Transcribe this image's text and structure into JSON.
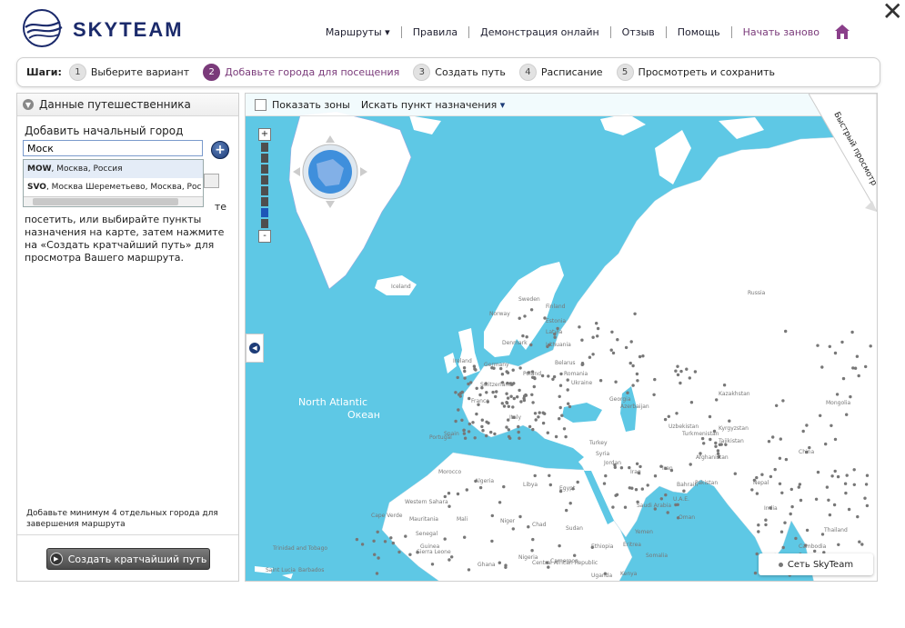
{
  "brand": {
    "name": "SKYTEAM"
  },
  "nav": {
    "items": [
      "Маршруты ▾",
      "Правила",
      "Демонстрация онлайн",
      "Отзыв",
      "Помощь",
      "Начать заново"
    ]
  },
  "close_label": "✕",
  "steps": {
    "label": "Шаги:",
    "items": [
      {
        "num": "1",
        "text": "Выберите вариант"
      },
      {
        "num": "2",
        "text": "Добавьте города для посещения"
      },
      {
        "num": "3",
        "text": "Создать путь"
      },
      {
        "num": "4",
        "text": "Расписание"
      },
      {
        "num": "5",
        "text": "Просмотреть и сохранить"
      }
    ],
    "active_index": 1
  },
  "sidebar": {
    "header": "Данные путешественника",
    "add_start_label": "Добавить начальный город",
    "city_input_value": "Моск",
    "suggestions": [
      {
        "code": "MOW",
        "rest": ", Москва, Россия"
      },
      {
        "code": "SVO",
        "rest": ", Москва Шереметьево, Москва, Рос"
      }
    ],
    "instructions_lead": "те",
    "instructions": "посетить, или выбирайте пункты назначения на карте, затем нажмите на «Создать кратчайший путь» для просмотра Вашего маршрута.",
    "min_note": "Добавьте минимум 4 отдельных города для завершения маршрута",
    "shortest_button": "Создать кратчайший путь"
  },
  "map": {
    "show_zones": "Показать зоны",
    "find_destination": "Искать пункт назначения",
    "quick_view": "Быстрый просмотр",
    "network_button": "Сеть SkyTeam",
    "ocean_label_1": "North Atlantic",
    "ocean_label_2": "Океан",
    "zoom_level": 7,
    "zoom_levels": 8,
    "country_labels": [
      {
        "t": "Iceland"
      },
      {
        "t": "Norway"
      },
      {
        "t": "Sweden"
      },
      {
        "t": "Finland"
      },
      {
        "t": "Estonia"
      },
      {
        "t": "Latvia"
      },
      {
        "t": "Lithuania"
      },
      {
        "t": "Belarus"
      },
      {
        "t": "Poland"
      },
      {
        "t": "Ukraine"
      },
      {
        "t": "France"
      },
      {
        "t": "Spain"
      },
      {
        "t": "Portugal"
      },
      {
        "t": "Italy"
      },
      {
        "t": "Turkey"
      },
      {
        "t": "Syria"
      },
      {
        "t": "Iraq"
      },
      {
        "t": "Iran"
      },
      {
        "t": "Libya"
      },
      {
        "t": "Egypt"
      },
      {
        "t": "Algeria"
      },
      {
        "t": "Morocco"
      },
      {
        "t": "Mali"
      },
      {
        "t": "Niger"
      },
      {
        "t": "Chad"
      },
      {
        "t": "Sudan"
      },
      {
        "t": "Ethiopia"
      },
      {
        "t": "Yemen"
      },
      {
        "t": "Kazakhstan"
      },
      {
        "t": "Uzbekistan"
      },
      {
        "t": "Turkmenistan"
      },
      {
        "t": "Kyrgyzstan"
      },
      {
        "t": "Afghanistan"
      },
      {
        "t": "Pakistan"
      },
      {
        "t": "China"
      },
      {
        "t": "Mongolia"
      },
      {
        "t": "Russia"
      },
      {
        "t": "Nepal"
      },
      {
        "t": "India"
      },
      {
        "t": "Thailand"
      },
      {
        "t": "Nigeria"
      },
      {
        "t": "Cameroon"
      },
      {
        "t": "Senegal"
      },
      {
        "t": "Mauritania"
      },
      {
        "t": "U.A.E."
      },
      {
        "t": "Oman"
      },
      {
        "t": "Eritrea"
      },
      {
        "t": "Somalia"
      },
      {
        "t": "Kenya"
      },
      {
        "t": "Uganda"
      },
      {
        "t": "Ghana"
      },
      {
        "t": "Tajikistan"
      },
      {
        "t": "Azerbaijan"
      },
      {
        "t": "Georgia"
      },
      {
        "t": "Germany"
      },
      {
        "t": "Switzerland"
      },
      {
        "t": "Romania"
      },
      {
        "t": "Denmark"
      },
      {
        "t": "Ireland"
      },
      {
        "t": "Malaysia"
      },
      {
        "t": "Cambodia"
      },
      {
        "t": "Central African Republic"
      },
      {
        "t": "Western Sahara"
      },
      {
        "t": "Sierra Leone"
      },
      {
        "t": "Guinea"
      },
      {
        "t": "Cape Verde"
      },
      {
        "t": "Trinidad and Tobago"
      },
      {
        "t": "Saint Lucia"
      },
      {
        "t": "Barbados"
      },
      {
        "t": "Bahrain"
      },
      {
        "t": "Jordan"
      },
      {
        "t": "Saudi Arabia"
      }
    ]
  },
  "colors": {
    "accent": "#7a3a7a",
    "brand": "#1b2a6b",
    "sea": "#5ec8e5",
    "land": "#ffffff"
  }
}
